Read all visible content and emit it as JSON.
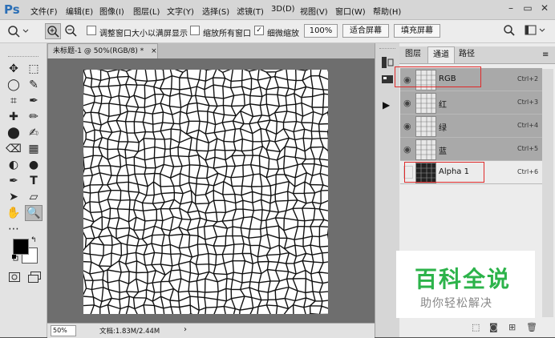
{
  "app": {
    "logo": "Ps"
  },
  "menu": [
    "文件(F)",
    "编辑(E)",
    "图像(I)",
    "图层(L)",
    "文字(Y)",
    "选择(S)",
    "滤镜(T)",
    "3D(D)",
    "视图(V)",
    "窗口(W)",
    "帮助(H)"
  ],
  "window_controls": {
    "minimize": "–",
    "restore": "▭",
    "close": "✕"
  },
  "options": {
    "zoom_tool_glyph": "🔍",
    "resize_windows_label": "调整窗口大小以满屏显示",
    "zoom_all_label": "缩放所有窗口",
    "scrubby_zoom_label": "细微缩放",
    "scrubby_checked": true,
    "percent_button": "100%",
    "fit_screen_button": "适合屏幕",
    "fill_screen_button": "填充屏幕"
  },
  "document": {
    "tab_title": "未标题-1 @ 50%(RGB/8) *",
    "tab_close": "×",
    "zoom_value": "50%",
    "doc_info": "文档:1.83M/2.44M",
    "arrow": "›"
  },
  "tools": [
    "✥",
    "⬚",
    "◯",
    "✎",
    "⌗",
    "✒",
    "✚",
    "✏",
    "⬤",
    "✍",
    "⌫",
    "▦",
    "◐",
    "●",
    "✒",
    "T",
    "➤",
    "▱",
    "✋",
    "🔍",
    "⋯"
  ],
  "panel_tabs": [
    "图层",
    "通道",
    "路径"
  ],
  "active_panel_tab": "通道",
  "channels": [
    {
      "name": "RGB",
      "shortcut": "Ctrl+2",
      "visible": true
    },
    {
      "name": "红",
      "shortcut": "Ctrl+3",
      "visible": true
    },
    {
      "name": "绿",
      "shortcut": "Ctrl+4",
      "visible": true
    },
    {
      "name": "蓝",
      "shortcut": "Ctrl+5",
      "visible": true
    },
    {
      "name": "Alpha 1",
      "shortcut": "Ctrl+6",
      "visible": false
    }
  ],
  "watermark": {
    "title": "百科全说",
    "subtitle": "助你轻松解决"
  },
  "colors": {
    "accent": "#2b6fb6",
    "highlight": "#e02a2a",
    "watermark_green": "#2cb34a"
  }
}
